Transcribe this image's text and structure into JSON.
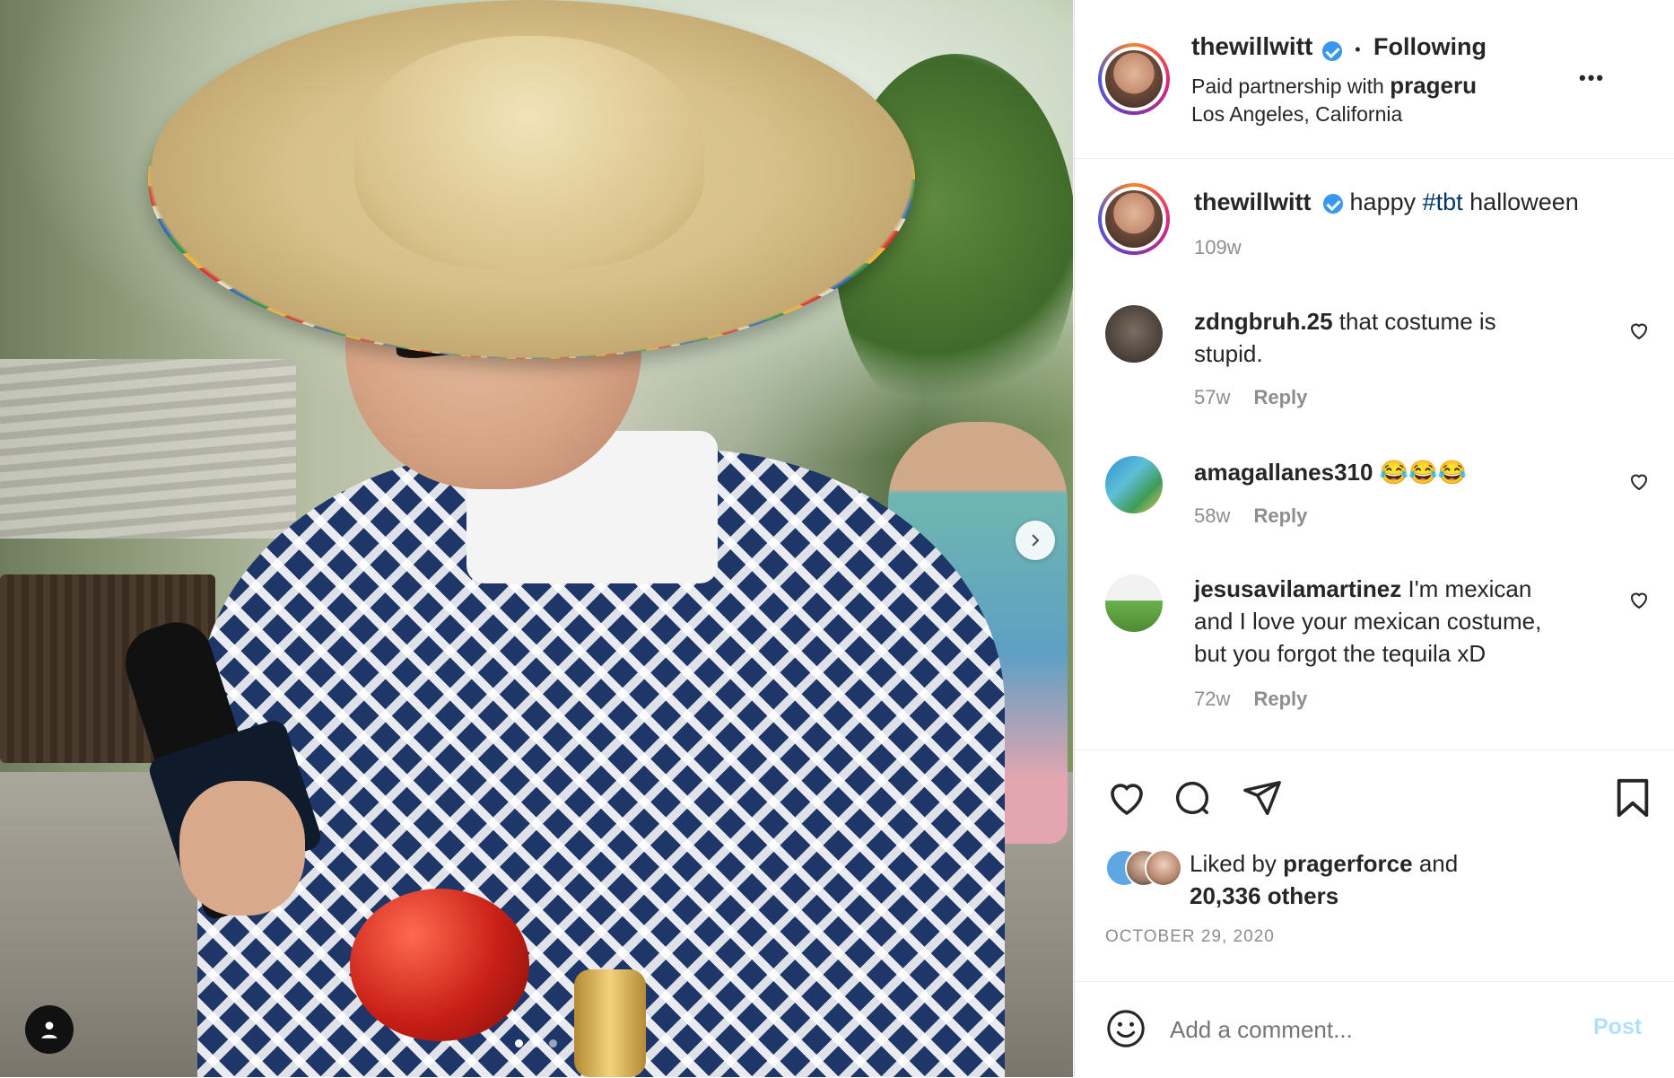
{
  "media": {
    "dot_count": 3,
    "active_dot": 0
  },
  "header": {
    "username": "thewillwitt",
    "separator": "•",
    "follow_status": "Following",
    "partnership_prefix": "Paid partnership with",
    "partner": "prageru",
    "location": "Los Angeles, California",
    "more_label": "•••"
  },
  "caption": {
    "username": "thewillwitt",
    "text_before": "happy ",
    "hashtag": "#tbt",
    "text_after": " halloween",
    "time": "109w"
  },
  "comments": [
    {
      "username": "zdngbruh.25",
      "text_line1": "that costume is",
      "text_line2": "stupid.",
      "text_line3": "",
      "time": "57w",
      "reply": "Reply"
    },
    {
      "username": "amagallanes310",
      "text_line1": "😂😂😂",
      "text_line2": "",
      "text_line3": "",
      "time": "58w",
      "reply": "Reply"
    },
    {
      "username": "jesusavilamartinez",
      "text_line1": "I'm mexican",
      "text_line2": "and I love your mexican costume,",
      "text_line3": "but you forgot the tequila xD",
      "time": "72w",
      "reply": "Reply"
    }
  ],
  "likes": {
    "prefix": "Liked by",
    "user": "pragerforce",
    "and": "and",
    "others": "20,336 others"
  },
  "date": "OCTOBER 29, 2020",
  "comment_input": {
    "placeholder": "Add a comment...",
    "post_label": "Post"
  },
  "colors": {
    "link_blue": "#00376b",
    "verified_blue": "#3897f0",
    "post_disabled": "#b2dffc",
    "muted": "#8e8e8e"
  }
}
